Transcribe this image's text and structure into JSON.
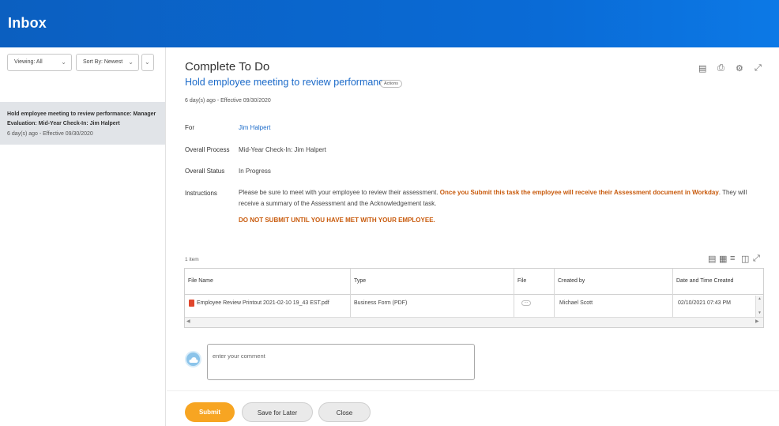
{
  "header": {
    "title": "Inbox"
  },
  "sidebar": {
    "viewing": "Viewing: All",
    "sort_by": "Sort By: Newest",
    "items": [
      {
        "title": "Hold employee meeting to review performance: Manager Evaluation: Mid-Year Check-In: Jim Halpert",
        "subtitle": "6 day(s) ago - Effective 09/30/2020"
      }
    ]
  },
  "main": {
    "page_title": "Complete To Do",
    "task_title": "Hold employee meeting to review performance",
    "actions_label": "Actions",
    "meta": "6 day(s) ago - Effective 09/30/2020",
    "fields": {
      "for_label": "For",
      "for_value": "Jim Halpert",
      "process_label": "Overall Process",
      "process_value": "Mid-Year Check-In: Jim Halpert",
      "status_label": "Overall Status",
      "status_value": "In Progress",
      "instructions_label": "Instructions"
    },
    "instructions": {
      "part1": "Please be sure to meet with your employee to review their assessment. ",
      "highlight": "Once you Submit this task the employee will receive their Assessment document in Workday",
      "part2": ". They will receive a summary of the Assessment and the Acknowledgement task.",
      "warning": "DO NOT SUBMIT UNTIL YOU HAVE MET WITH YOUR EMPLOYEE."
    },
    "table": {
      "count": "1 item",
      "columns": [
        "File Name",
        "Type",
        "File",
        "Created by",
        "Date and Time Created"
      ],
      "rows": [
        {
          "file_name": "Employee Review Printout 2021-02-10 19_43 EST.pdf",
          "type": "Business Form (PDF)",
          "file": "···",
          "created_by": "Michael Scott",
          "created_at": "02/10/2021 07:43 PM"
        }
      ]
    },
    "comment": {
      "placeholder": "enter your comment"
    },
    "buttons": {
      "submit": "Submit",
      "save": "Save for Later",
      "close": "Close"
    }
  },
  "icons": {
    "excel": "excel-export-icon",
    "print": "print-icon",
    "settings": "gear-icon",
    "expand": "expand-icon",
    "pdf": "pdf-file-icon",
    "avatar": "cloud-avatar-icon"
  },
  "colors": {
    "header": "#0b5fc0",
    "link": "#1b6ac9",
    "highlight": "#c85a0c",
    "submit": "#f7a522"
  }
}
